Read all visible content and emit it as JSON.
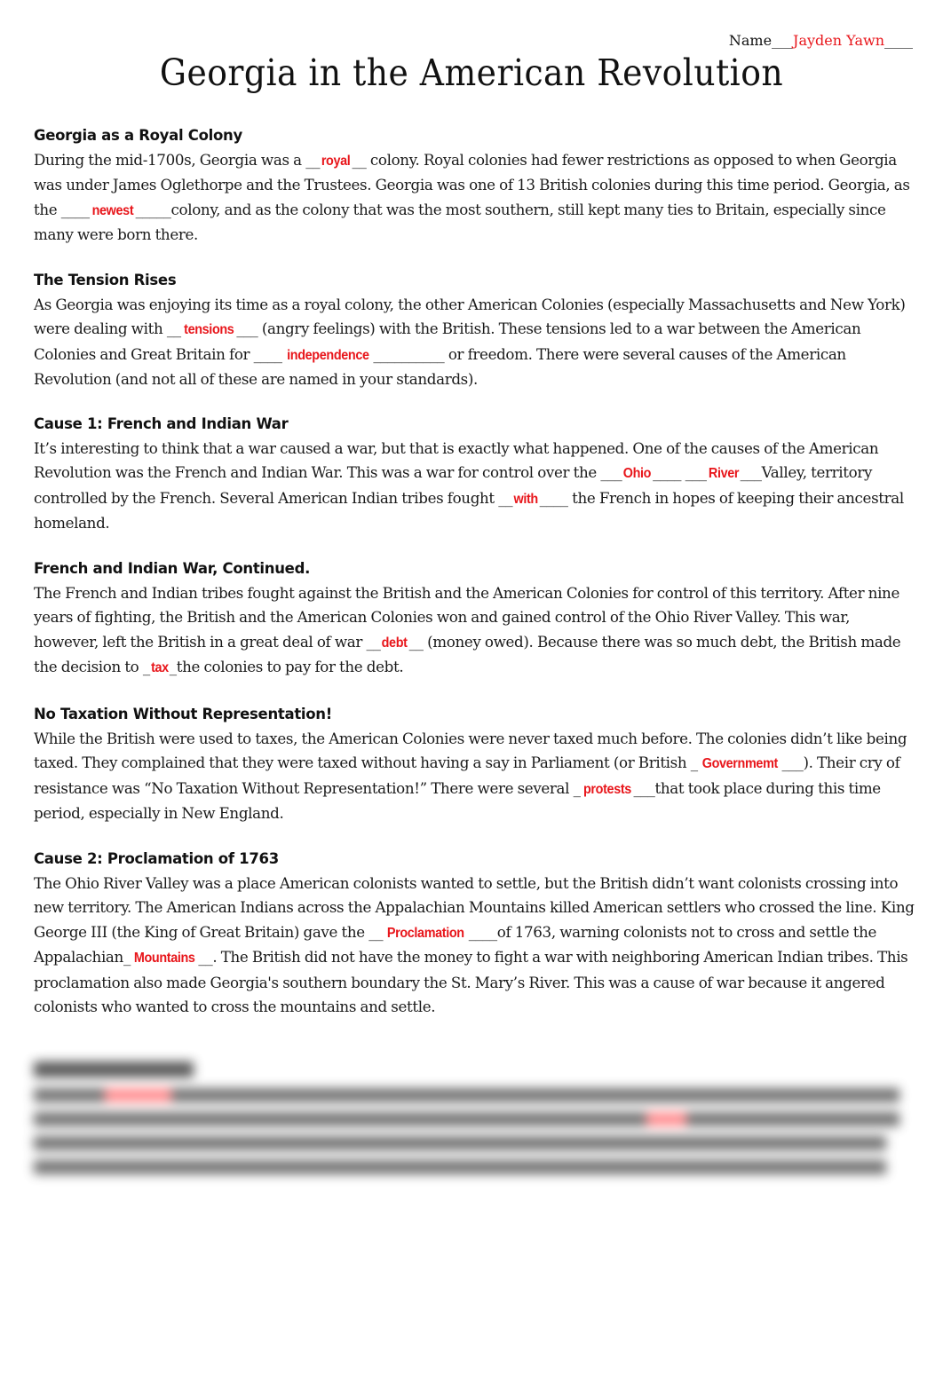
{
  "header": {
    "name_label": "Name",
    "name_blank_before": "___",
    "name_value": "Jayden Yawn",
    "name_blank_after": "____",
    "title": "Georgia in the American Revolution"
  },
  "accent_color": "#e8161b",
  "sections": [
    {
      "heading": "Georgia as a Royal Colony",
      "p": [
        "During the mid-1700s, Georgia was a ",
        "__",
        "royal",
        "__",
        " colony. Royal colonies had fewer restrictions as opposed to when Georgia was under James Oglethorpe and the Trustees.  Georgia was one of 13 British colonies during this time period.  Georgia, as the ",
        "____",
        "newest",
        "_____",
        "colony, and as the colony that was the most southern, still kept many ties to Britain, especially since many were born there."
      ]
    },
    {
      "heading": "The Tension Rises",
      "p": [
        "As Georgia was enjoying its time as a royal colony, the other American Colonies (especially Massachusetts and New York) were dealing with ",
        "__",
        "tensions",
        "___",
        " (angry feelings) with the British.  These tensions led to a war between the American Colonies and Great Britain for ",
        "____",
        "independence",
        "__________",
        "  or freedom. There were several causes of the American Revolution (and not all of these are named in your standards)."
      ]
    },
    {
      "heading": "Cause 1: French and Indian War",
      "p": [
        "It’s interesting to think that a war caused a war, but that is exactly what happened.  One of the causes of the American Revolution was the French and Indian War.  This was a war for control over the ",
        "___",
        "Ohio",
        "____",
        " ",
        "___",
        "River",
        "___",
        "Valley, territory controlled by the French.  Several American Indian tribes fought ",
        "__",
        "with",
        "____",
        " the French in hopes of keeping their ancestral homeland."
      ]
    },
    {
      "heading": "French and Indian War, Continued.",
      "p": [
        "The French and Indian tribes fought against the British and the American Colonies for control of this territory. After nine years of fighting, the British and the American Colonies won and gained control of the Ohio River Valley. This war, however, left the British in a great deal of war ",
        "__",
        "debt",
        "__",
        " (money owed).  Because there was so much debt, the British made the decision to ",
        "_",
        "tax",
        "_",
        "the colonies to pay for the debt."
      ]
    },
    {
      "heading": "No Taxation Without Representation!",
      "p": [
        "While the British were used to taxes, the American Colonies were never taxed much before. The colonies didn’t like being taxed.  They complained that they were taxed without having a say in Parliament (or British ",
        "_",
        "Governmemt",
        "___",
        ").  Their cry of resistance was “No Taxation Without Representation!” There were several ",
        "_",
        "protests",
        "___",
        "that took place during this time period, especially in New England."
      ]
    },
    {
      "heading": "Cause 2: Proclamation of 1763",
      "p": [
        "The Ohio River Valley was a place American colonists wanted to settle, but the British didn’t want colonists crossing into new territory.  The American Indians across the Appalachian Mountains killed American settlers who crossed the line.  King George III (the King of Great Britain) gave the  ",
        "__",
        "Proclamation",
        "____",
        "of 1763, warning colonists not to cross and settle the Appalachian",
        "_",
        "Mountains",
        "__",
        ".  The British did not  have the money to fight a war with neighboring American Indian tribes. This proclamation also made Georgia's southern boundary the St. Mary’s River.  This was a cause of war because it angered colonists who wanted to cross the mountains and settle."
      ]
    }
  ],
  "blurred_section": {
    "note": "content obscured"
  }
}
